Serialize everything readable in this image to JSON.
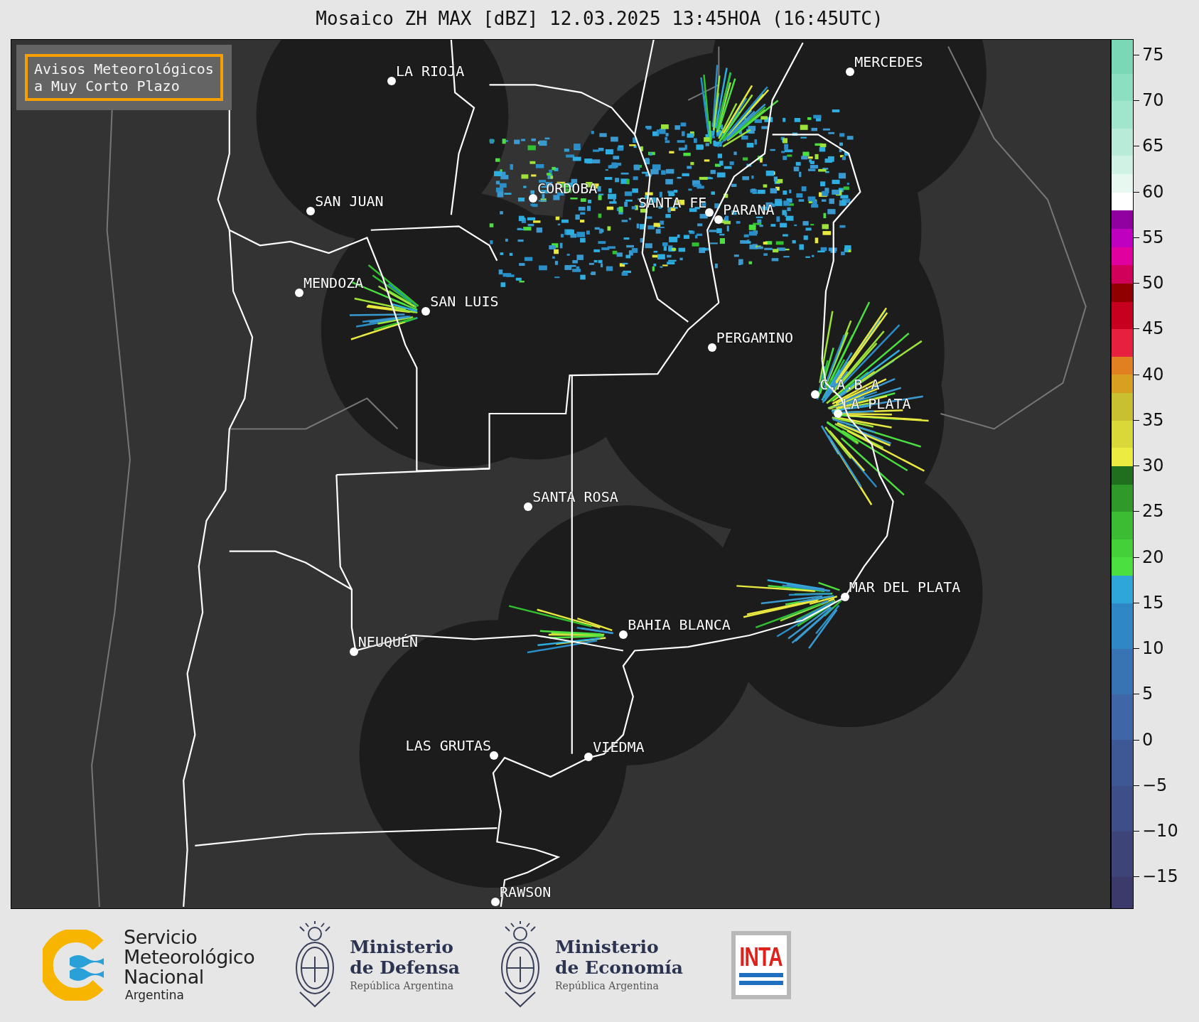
{
  "title": "Mosaico ZH MAX [dBZ] 12.03.2025 13:45HOA (16:45UTC)",
  "notice": {
    "lines": [
      "Avisos Meteorológicos",
      "a Muy Corto Plazo"
    ]
  },
  "cities": [
    {
      "name": "LA RIOJA"
    },
    {
      "name": "MERCEDES"
    },
    {
      "name": "CORDOBA"
    },
    {
      "name": "SAN JUAN"
    },
    {
      "name": "SANTA FE"
    },
    {
      "name": "PARANA"
    },
    {
      "name": "MENDOZA"
    },
    {
      "name": "SAN LUIS"
    },
    {
      "name": "PERGAMINO"
    },
    {
      "name": "C.A.B.A"
    },
    {
      "name": "LA PLATA"
    },
    {
      "name": "SANTA ROSA"
    },
    {
      "name": "MAR DEL PLATA"
    },
    {
      "name": "BAHIA BLANCA"
    },
    {
      "name": "NEUQUÉN"
    },
    {
      "name": "LAS GRUTAS"
    },
    {
      "name": "VIEDMA"
    },
    {
      "name": "RAWSON"
    }
  ],
  "colorbar": {
    "ticks": [
      "75",
      "70",
      "65",
      "60",
      "55",
      "50",
      "45",
      "40",
      "35",
      "30",
      "25",
      "20",
      "15",
      "10",
      "5",
      "0",
      "−5",
      "−10",
      "−15"
    ]
  },
  "logos": [
    {
      "kind": "smn",
      "lines": [
        "Servicio",
        "Meteorológico",
        "Nacional"
      ],
      "subtitle": "Argentina"
    },
    {
      "kind": "ministry",
      "lines": [
        "Ministerio",
        "de Defensa"
      ],
      "subtitle": "República Argentina"
    },
    {
      "kind": "ministry",
      "lines": [
        "Ministerio",
        "de Economía"
      ],
      "subtitle": "República Argentina"
    },
    {
      "kind": "inta",
      "lines": [
        "INTA"
      ]
    }
  ]
}
